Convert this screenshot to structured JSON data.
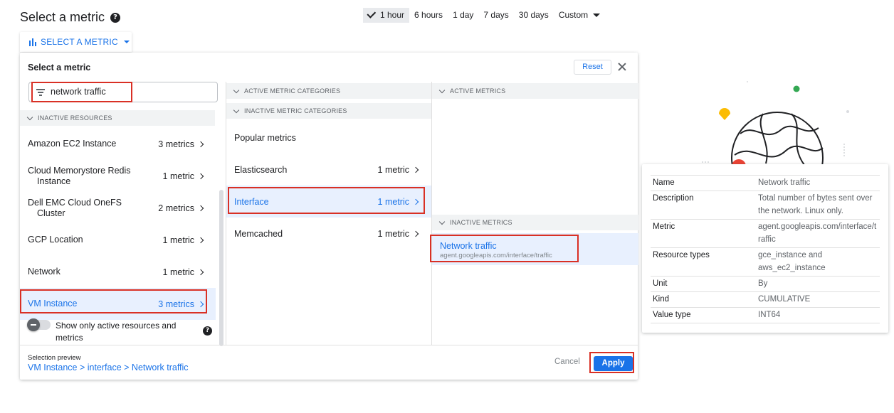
{
  "header": {
    "title": "Select a metric",
    "help": "?",
    "time_ranges": [
      "1 hour",
      "6 hours",
      "1 day",
      "7 days",
      "30 days",
      "Custom"
    ],
    "selected_time_range": "1 hour"
  },
  "select_button": {
    "label": "SELECT A METRIC"
  },
  "dialog": {
    "title": "Select a metric",
    "reset_label": "Reset",
    "filter_value": "network traffic",
    "resources_header": "INACTIVE RESOURCES",
    "resources": [
      {
        "name": "Amazon EC2 Instance",
        "count": "3 metrics"
      },
      {
        "name": "Cloud Memorystore Redis",
        "name2": "Instance",
        "count": "1 metric"
      },
      {
        "name": "Dell EMC Cloud OneFS",
        "name2": "Cluster",
        "count": "2 metrics"
      },
      {
        "name": "GCP Location",
        "count": "1 metric"
      },
      {
        "name": "Network",
        "count": "1 metric"
      },
      {
        "name": "VM Instance",
        "count": "3 metrics"
      }
    ],
    "toggle_label": "Show only active resources and metrics",
    "active_categories_header": "ACTIVE METRIC CATEGORIES",
    "inactive_categories_header": "INACTIVE METRIC CATEGORIES",
    "categories": [
      {
        "name": "Popular metrics",
        "count": ""
      },
      {
        "name": "Elasticsearch",
        "count": "1 metric"
      },
      {
        "name": "Interface",
        "count": "1 metric"
      },
      {
        "name": "Memcached",
        "count": "1 metric"
      }
    ],
    "active_metrics_header": "ACTIVE METRICS",
    "inactive_metrics_header": "INACTIVE METRICS",
    "metric": {
      "name": "Network traffic",
      "id": "agent.googleapis.com/interface/traffic"
    },
    "preview_label": "Selection preview",
    "preview_path": "VM Instance > interface > Network traffic",
    "cancel_label": "Cancel",
    "apply_label": "Apply"
  },
  "info": {
    "rows": [
      {
        "key": "Name",
        "value": "Network traffic"
      },
      {
        "key": "Description",
        "value": "Total number of bytes sent over the network. Linux only."
      },
      {
        "key": "Metric",
        "value": "agent.googleapis.com/interface/traffic"
      },
      {
        "key": "Resource types",
        "value": "gce_instance and aws_ec2_instance"
      },
      {
        "key": "Unit",
        "value": "By"
      },
      {
        "key": "Kind",
        "value": "CUMULATIVE"
      },
      {
        "key": "Value type",
        "value": "INT64"
      }
    ]
  },
  "colors": {
    "accent": "#1a73e8",
    "highlight": "#d93025",
    "selected_bg": "#e8f0fe"
  }
}
